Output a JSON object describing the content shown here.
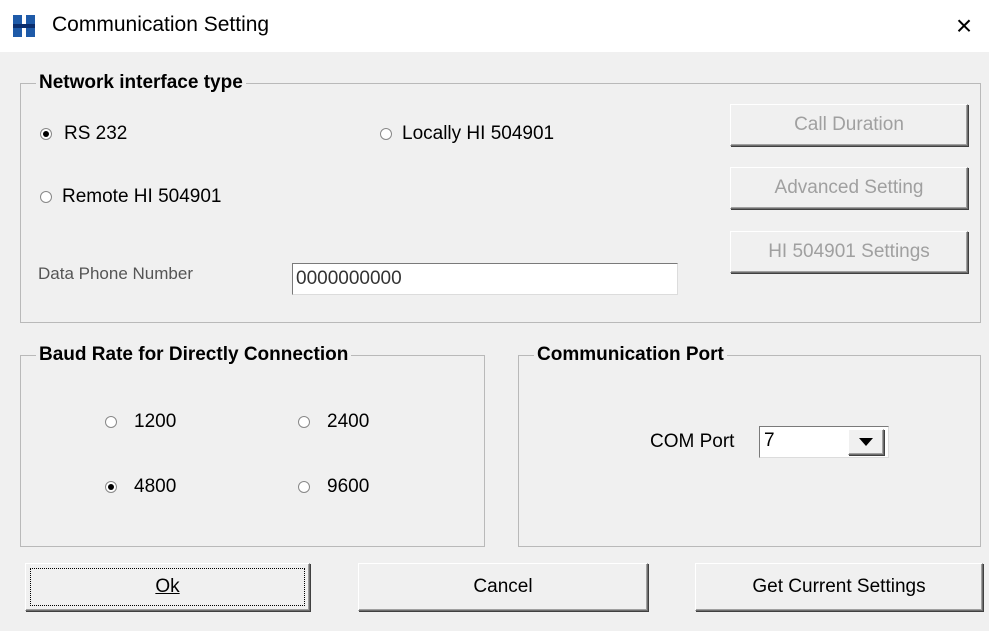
{
  "window": {
    "title": "Communication Setting",
    "close_glyph": "×"
  },
  "network": {
    "group_title": "Network interface type",
    "options": [
      {
        "label": "RS 232",
        "selected": true
      },
      {
        "label": "Locally HI 504901",
        "selected": false
      },
      {
        "label": "Remote HI 504901",
        "selected": false
      }
    ],
    "phone_label": "Data Phone Number",
    "phone_value": "0000000000",
    "buttons": {
      "call_duration": "Call Duration",
      "advanced": "Advanced Setting",
      "hi_settings": "HI 504901 Settings"
    }
  },
  "baud": {
    "group_title": "Baud Rate for Directly Connection",
    "options": [
      {
        "label": "1200",
        "selected": false
      },
      {
        "label": "2400",
        "selected": false
      },
      {
        "label": "4800",
        "selected": true
      },
      {
        "label": "9600",
        "selected": false
      }
    ]
  },
  "port": {
    "group_title": "Communication Port",
    "label": "COM Port",
    "value": "7"
  },
  "footer": {
    "ok_label": "Ok",
    "cancel_label": "Cancel",
    "get_settings_label": "Get Current Settings"
  }
}
